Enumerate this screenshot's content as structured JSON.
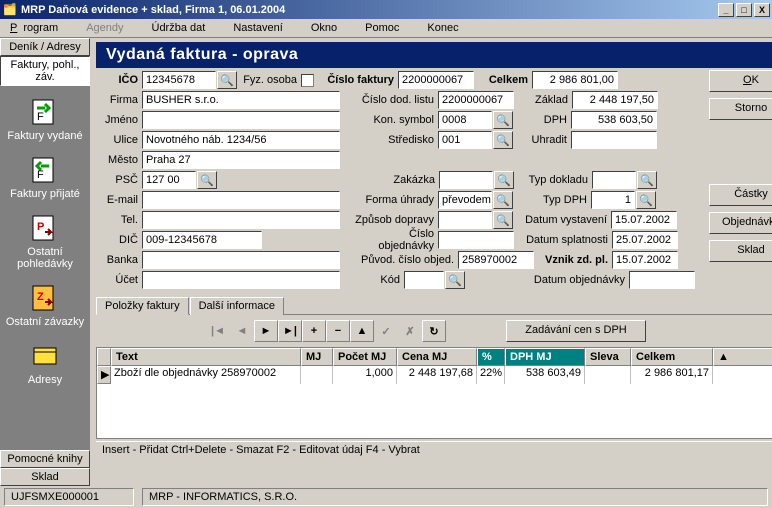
{
  "window": {
    "title": "MRP Daňová evidence + sklad,  Firma 1,  06.01.2004"
  },
  "menu": {
    "m1": "Program",
    "m2": "Agendy",
    "m3": "Údržba dat",
    "m4": "Nastavení",
    "m5": "Okno",
    "m6": "Pomoc",
    "m7": "Konec"
  },
  "sidebar": {
    "tab1": "Deník / Adresy",
    "tab2": "Faktury, pohl., záv.",
    "items": [
      {
        "label": "Faktury vydané"
      },
      {
        "label": "Faktury přijaté"
      },
      {
        "label": "Ostatní pohledávky"
      },
      {
        "label": "Ostatní závazky"
      },
      {
        "label": "Adresy"
      }
    ],
    "bottom1": "Pomocné knihy",
    "bottom2": "Sklad"
  },
  "header": "Vydaná faktura    -    oprava",
  "labels": {
    "ico": "IČO",
    "firma": "Firma",
    "jmeno": "Jméno",
    "ulice": "Ulice",
    "mesto": "Město",
    "psc": "PSČ",
    "email": "E-mail",
    "tel": "Tel.",
    "dic": "DIČ",
    "banka": "Banka",
    "ucet": "Účet",
    "fyzosoba": "Fyz. osoba",
    "cislofaktury": "Číslo faktury",
    "cislodod": "Číslo dod. listu",
    "konsymbol": "Kon. symbol",
    "stredisko": "Středisko",
    "zakazka": "Zakázka",
    "formauhrady": "Forma úhrady",
    "zpusobdop": "Způsob dopravy",
    "cisloobj": "Číslo objednávky",
    "puvodobj": "Původ. číslo objed.",
    "kod": "Kód",
    "celkem": "Celkem",
    "zaklad": "Základ",
    "dph": "DPH",
    "uhradit": "Uhradit",
    "typdokladu": "Typ dokladu",
    "typdph": "Typ DPH",
    "datvyst": "Datum vystavení",
    "datspl": "Datum splatnosti",
    "vznikzd": "Vznik zd. pl.",
    "datobj": "Datum objednávky"
  },
  "values": {
    "ico": "12345678",
    "firma": "BUSHER s.r.o.",
    "jmeno": "",
    "ulice": "Novotného náb. 1234/56",
    "mesto": "Praha 27",
    "psc": "127 00",
    "email": "",
    "tel": "",
    "dic": "009-12345678",
    "banka": "",
    "ucet": "",
    "cislofaktury": "2200000067",
    "cislodod": "2200000067",
    "konsymbol": "0008",
    "stredisko": "001",
    "zakazka": "",
    "formauhrady": "převodem",
    "zpusobdop": "",
    "cisloobj": "",
    "puvodobj": "258970002",
    "kod": "",
    "celkem": "2 986 801,00",
    "zaklad": "2 448 197,50",
    "dph": "538 603,50",
    "uhradit": "",
    "typdokladu": "",
    "typdph": "1",
    "datvyst": "15.07.2002",
    "datspl": "25.07.2002",
    "vznikzd": "15.07.2002",
    "datobj": ""
  },
  "buttons": {
    "ok": "OK",
    "storno": "Storno",
    "castky": "Částky",
    "objednavky": "Objednávky",
    "sklad": "Sklad",
    "zadavani": "Zadávání cen s DPH"
  },
  "tabs": {
    "t1": "Položky faktury",
    "t2": "Další informace"
  },
  "grid": {
    "cols": {
      "text": "Text",
      "mj": "MJ",
      "pocet": "Počet MJ",
      "cena": "Cena MJ",
      "pct": "%",
      "dphmj": "DPH MJ",
      "sleva": "Sleva",
      "celkem": "Celkem"
    },
    "rows": [
      {
        "text": "Zboží dle objednávky 258970002",
        "mj": "",
        "pocet": "1,000",
        "cena": "2 448 197,68",
        "pct": "22%",
        "dphmj": "538 603,49",
        "sleva": "",
        "celkem": "2 986 801,17"
      }
    ]
  },
  "status": {
    "hint": "Insert - Přidat    Ctrl+Delete - Smazat    F2 - Editovat údaj    F4 - Vybrat",
    "code": "UJFSMXE000001",
    "company": "MRP - INFORMATICS, S.R.O."
  }
}
